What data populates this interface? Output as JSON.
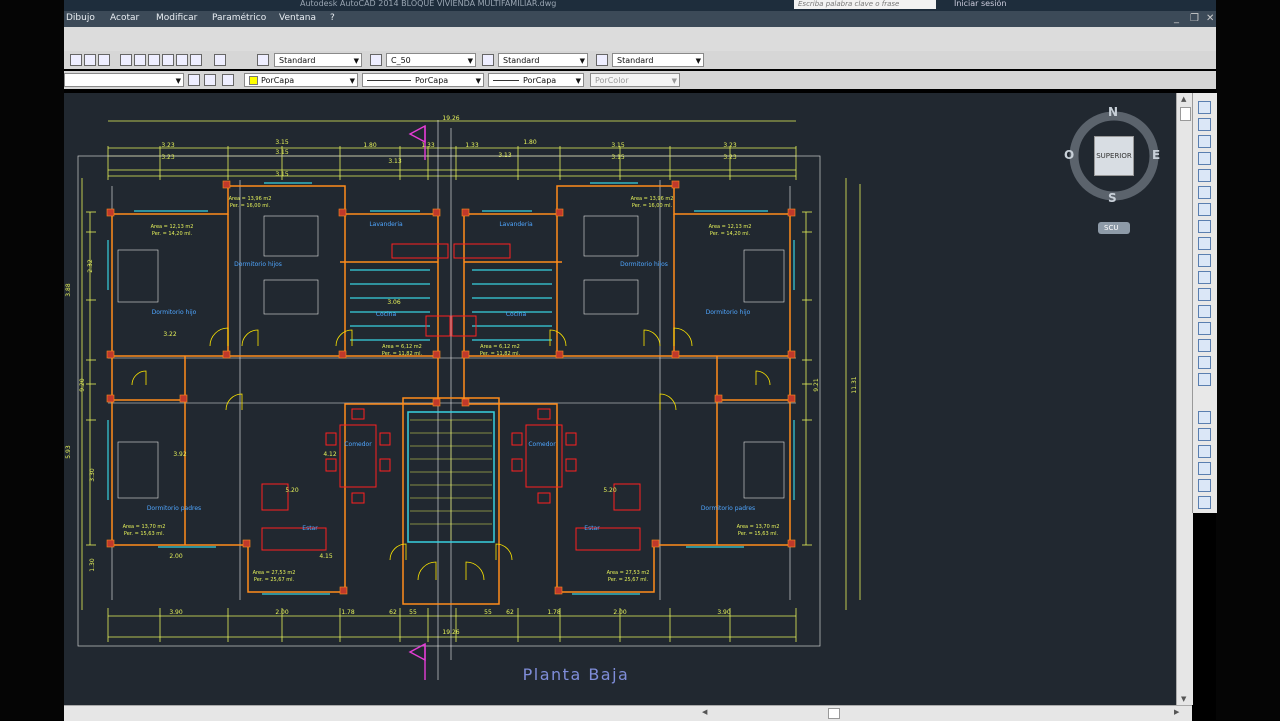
{
  "window": {
    "title": "Autodesk AutoCAD 2014    BLOQUE VIVIENDA MULTIFAMILIAR.dwg",
    "search_placeholder": "Escriba palabra clave o frase",
    "sign_in": "Iniciar sesión"
  },
  "menu": {
    "items": [
      "Dibujo",
      "Acotar",
      "Modificar",
      "Paramétrico",
      "Ventana",
      "?"
    ]
  },
  "toolbar": {
    "text_style": "Standard",
    "dim_style": "C_50",
    "table_style": "Standard",
    "multileader_style": "Standard",
    "layer_color": "PorCapa",
    "linetype": "PorCapa",
    "lineweight": "PorCapa",
    "plot_style": "PorColor"
  },
  "viewcube": {
    "north": "N",
    "south": "S",
    "east": "E",
    "west": "O",
    "face": "SUPERIOR",
    "ucs": "SCU"
  },
  "drawing": {
    "title": "Planta Baja",
    "top_dims": [
      "19.26",
      "3.23",
      "3.15",
      "1.80",
      "1.33",
      "1.33",
      "1.80",
      "3.15",
      "3.23",
      "3.23",
      "3.15",
      "3.13",
      "3.13",
      "3.15",
      "3.23"
    ],
    "bottom_dims": [
      "3.90",
      "2.00",
      "1.78",
      "62",
      "55",
      "55",
      "62",
      "1.78",
      "2.00",
      "3.90",
      "19.26"
    ],
    "side_dims": [
      "3.88",
      "2.32",
      "9.20",
      "5.93",
      "3.30",
      "1.30",
      "11.31",
      "9.21"
    ],
    "room_labels": [
      "Dormitorio hijos",
      "Dormitorio hijo",
      "Dormitorio hijos",
      "Dormitorio hijo",
      "Cocina",
      "Cocina",
      "Comedor",
      "Comedor",
      "Estar",
      "Estar",
      "Dormitorio padres",
      "Dormitorio padres",
      "Lavanderia",
      "Lavanderia"
    ],
    "area_labels": [
      "Area = 13,96 m2",
      "Per. = 16,00 ml.",
      "Area = 12,13 m2",
      "Per. = 14,20 ml.",
      "Area = 6,12 m2",
      "Per. = 11,82 ml.",
      "Area = 27,53 m2",
      "Per. = 25,67 ml.",
      "Area = 13,70 m2",
      "Per. = 15,63 ml."
    ],
    "interior_dims": [
      "3.06",
      "3.22",
      "3.92",
      "4.12",
      "5.20",
      "4.15",
      "2.00",
      "3.15",
      "5.20"
    ]
  },
  "colors": {
    "canvas": "#212830",
    "wall": "#ff8c1a",
    "wall_fill": "#c0392b",
    "dim": "#e6f25a",
    "axis": "#f0f0f0",
    "door": "#ffe800",
    "cyan": "#38d1e0",
    "magenta": "#e53cd6",
    "blue": "#4fa6ff",
    "red": "#ff2020",
    "title": "#7f8dd9"
  }
}
